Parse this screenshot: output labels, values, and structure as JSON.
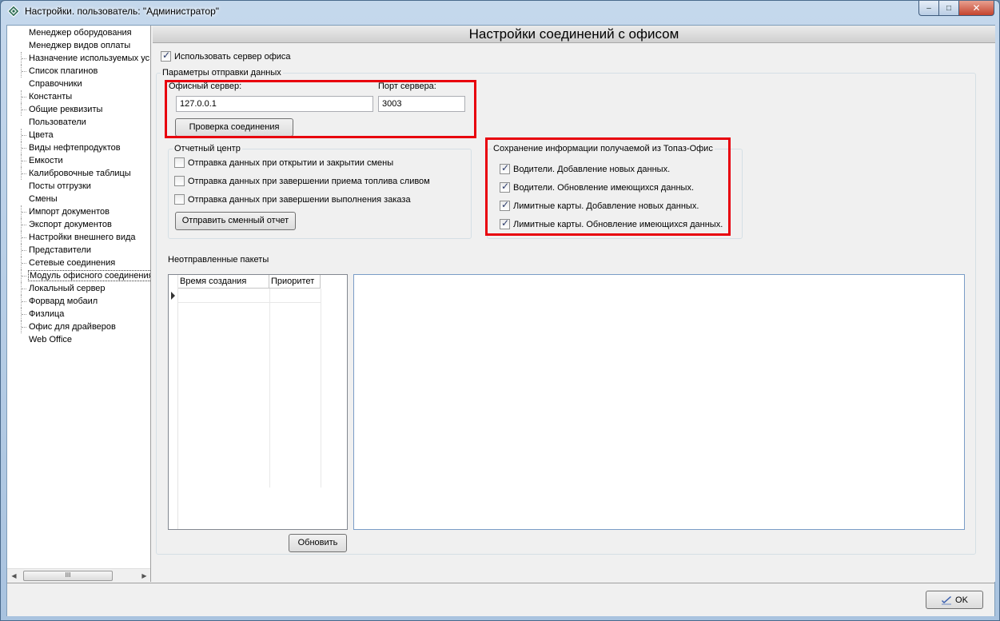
{
  "window": {
    "title": "Настройки. пользователь: \"Администратор\"",
    "controls": {
      "minimize": "–",
      "maximize": "□",
      "close": "✕"
    }
  },
  "tree": {
    "items": [
      {
        "label": "Менеджер оборудования",
        "expandable": true
      },
      {
        "label": "Менеджер видов оплаты",
        "expandable": true
      },
      {
        "label": "Назначение используемых ус",
        "expandable": false
      },
      {
        "label": "Список плагинов",
        "expandable": false
      },
      {
        "label": "Справочники",
        "expandable": true
      },
      {
        "label": "Константы",
        "expandable": false
      },
      {
        "label": "Общие реквизиты",
        "expandable": false
      },
      {
        "label": "Пользователи",
        "expandable": true
      },
      {
        "label": "Цвета",
        "expandable": false
      },
      {
        "label": "Виды нефтепродуктов",
        "expandable": false
      },
      {
        "label": "Емкости",
        "expandable": false
      },
      {
        "label": "Калибровочные таблицы",
        "expandable": false
      },
      {
        "label": "Посты отгрузки",
        "expandable": true
      },
      {
        "label": "Смены",
        "expandable": true
      },
      {
        "label": "Импорт документов",
        "expandable": false
      },
      {
        "label": "Экспорт документов",
        "expandable": false
      },
      {
        "label": "Настройки внешнего вида",
        "expandable": false
      },
      {
        "label": "Представители",
        "expandable": false
      },
      {
        "label": "Сетевые соединения",
        "expandable": false
      },
      {
        "label": "Модуль офисного соединения",
        "expandable": false,
        "selected": true
      },
      {
        "label": "Локальный сервер",
        "expandable": false
      },
      {
        "label": "Форвард мобаил",
        "expandable": false
      },
      {
        "label": "Физлица",
        "expandable": false
      },
      {
        "label": "Офис для драйверов",
        "expandable": false
      },
      {
        "label": "Web Office",
        "expandable": true
      }
    ],
    "scroll_thumb_glyph": "III"
  },
  "main": {
    "header_title": "Настройки соединений с офисом",
    "use_office_server": {
      "label": "Использовать сервер офиса",
      "checked": true
    },
    "send_params_legend": "Параметры отправки данных",
    "office_server_label": "Офисный сервер:",
    "office_server_value": "127.0.0.1",
    "server_port_label": "Порт сервера:",
    "server_port_value": "3003",
    "check_connection_button": "Проверка соединения",
    "report_center": {
      "legend": "Отчетный центр",
      "options": [
        {
          "label": "Отправка данных при открытии и закрытии смены",
          "checked": false
        },
        {
          "label": "Отправка данных при завершении приема топлива сливом",
          "checked": false
        },
        {
          "label": "Отправка данных при завершении выполнения заказа",
          "checked": false
        }
      ],
      "send_shift_report_button": "Отправить сменный отчет"
    },
    "topaz_office": {
      "legend": "Сохранение информации получаемой из Топаз-Офис",
      "options": [
        {
          "label": "Водители. Добавление новых данных.",
          "checked": true
        },
        {
          "label": "Водители. Обновление имеющихся данных.",
          "checked": true
        },
        {
          "label": "Лимитные карты. Добавление новых данных.",
          "checked": true
        },
        {
          "label": "Лимитные карты. Обновление имеющихся данных.",
          "checked": true
        }
      ]
    },
    "unsent_packets": {
      "legend": "Неотправленные пакеты",
      "columns": [
        "Время создания",
        "Приоритет"
      ],
      "refresh_button": "Обновить"
    }
  },
  "footer": {
    "ok_button": "OK"
  },
  "colors": {
    "highlight_border": "#e8000d",
    "window_frame": "#a9c3df"
  }
}
